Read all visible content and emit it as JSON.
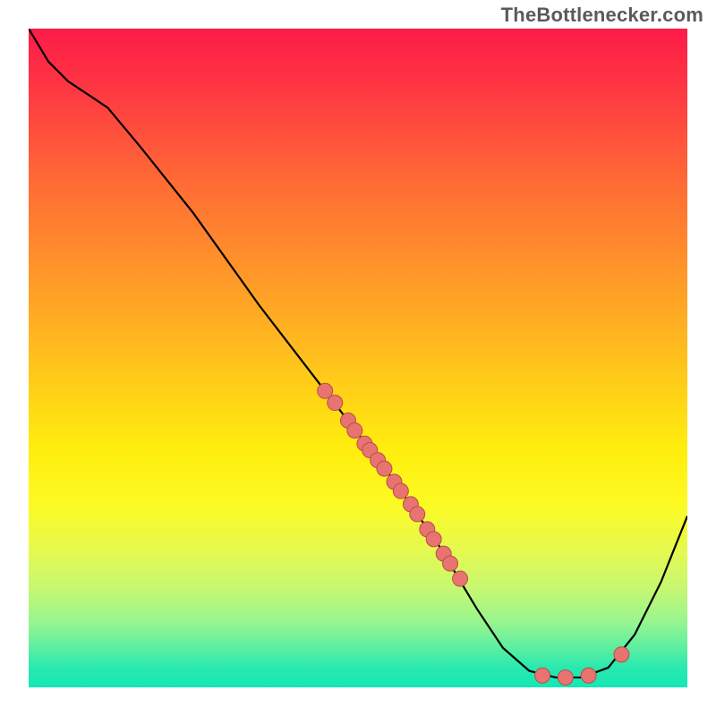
{
  "watermark": "TheBottlenecker.com",
  "chart_data": {
    "type": "line",
    "title": "",
    "xlabel": "",
    "ylabel": "",
    "x_range": [
      0,
      100
    ],
    "y_range": [
      0,
      100
    ],
    "curve": [
      {
        "x": 0,
        "y": 100
      },
      {
        "x": 3,
        "y": 95
      },
      {
        "x": 6,
        "y": 92
      },
      {
        "x": 9,
        "y": 90
      },
      {
        "x": 12,
        "y": 88
      },
      {
        "x": 17,
        "y": 82
      },
      {
        "x": 25,
        "y": 72
      },
      {
        "x": 35,
        "y": 58
      },
      {
        "x": 45,
        "y": 45
      },
      {
        "x": 55,
        "y": 32
      },
      {
        "x": 62,
        "y": 22
      },
      {
        "x": 68,
        "y": 12
      },
      {
        "x": 72,
        "y": 6
      },
      {
        "x": 76,
        "y": 2.5
      },
      {
        "x": 80,
        "y": 1.5
      },
      {
        "x": 84,
        "y": 1.5
      },
      {
        "x": 88,
        "y": 3
      },
      {
        "x": 92,
        "y": 8
      },
      {
        "x": 96,
        "y": 16
      },
      {
        "x": 100,
        "y": 26
      }
    ],
    "scatter_points": [
      {
        "x": 45,
        "y": 45
      },
      {
        "x": 46.5,
        "y": 43.2
      },
      {
        "x": 48.5,
        "y": 40.5
      },
      {
        "x": 49.5,
        "y": 39
      },
      {
        "x": 51,
        "y": 37
      },
      {
        "x": 51.8,
        "y": 36
      },
      {
        "x": 53,
        "y": 34.5
      },
      {
        "x": 54,
        "y": 33.2
      },
      {
        "x": 55.5,
        "y": 31.2
      },
      {
        "x": 56.5,
        "y": 29.8
      },
      {
        "x": 58,
        "y": 27.8
      },
      {
        "x": 59,
        "y": 26.3
      },
      {
        "x": 60.5,
        "y": 24
      },
      {
        "x": 61.5,
        "y": 22.5
      },
      {
        "x": 63,
        "y": 20.3
      },
      {
        "x": 64,
        "y": 18.8
      },
      {
        "x": 65.5,
        "y": 16.5
      },
      {
        "x": 78,
        "y": 1.8
      },
      {
        "x": 81.5,
        "y": 1.5
      },
      {
        "x": 85,
        "y": 1.8
      },
      {
        "x": 90,
        "y": 5
      }
    ],
    "point_color": "#e77470",
    "point_stroke": "#b94d4a",
    "curve_color": "#000000",
    "gradient": {
      "top": "#fd1b48",
      "upper_mid": "#ff8d2c",
      "mid": "#ffee0f",
      "lower_mid": "#99f58f",
      "bottom": "#14e7b6"
    }
  }
}
